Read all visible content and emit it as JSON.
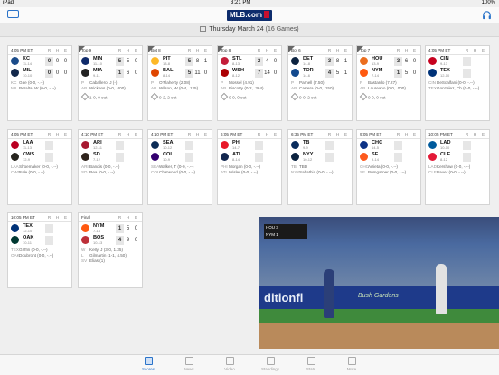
{
  "status": {
    "left": "iPad",
    "time": "3:21 PM",
    "battery": "100%"
  },
  "header": {
    "logo": "MLB.com",
    "date_bar": "Thursday March 24",
    "games": "(16 Games)"
  },
  "cards": [
    {
      "status": "4:05 PM ET",
      "t1": "KC",
      "r1": "11-14",
      "s1": [
        "0",
        "0",
        "0"
      ],
      "t2": "MIL",
      "r2": "10-10",
      "s2": [
        "0",
        "0",
        "0"
      ],
      "l1": [
        "KC",
        "Gee (0-0, -.--)"
      ],
      "l2": [
        "MIL",
        "Peralta, W (0-0, -.--)"
      ]
    },
    {
      "status": "Top 9",
      "t1": "MIN",
      "r1": "11-10",
      "s1": [
        "5",
        "5",
        "0"
      ],
      "t2": "MIA",
      "r2": "9-11",
      "s2": [
        "1",
        "6",
        "0"
      ],
      "l1": [
        "P",
        "Caballero, J (-)"
      ],
      "l2": [
        "AB",
        "Wickens (0-0, .000)"
      ],
      "outs": "1-0, 0 out"
    },
    {
      "status": "Bot 8",
      "t1": "PIT",
      "r1": "13-8",
      "s1": [
        "5",
        "8",
        "1"
      ],
      "t2": "BAL",
      "r2": "8-14",
      "s2": [
        "5",
        "11",
        "0"
      ],
      "l1": [
        "P",
        "O'Flaherty (2.08)"
      ],
      "l2": [
        "AB",
        "Wilson, W (0-4, .125)"
      ],
      "outs": "0-2, 2 out"
    },
    {
      "status": "Top 8",
      "t1": "STL",
      "r1": "8-13",
      "s1": [
        "2",
        "4",
        "0"
      ],
      "t2": "WSH",
      "r2": "8-12",
      "s2": [
        "7",
        "14",
        "0"
      ],
      "l1": [
        "P",
        "Mossel (4.91)"
      ],
      "l2": [
        "AB",
        "Piscotty (0-2, .364)"
      ],
      "outs": "0-0, 0 out"
    },
    {
      "status": "Bot 6",
      "t1": "DET",
      "r1": "14-8",
      "s1": [
        "3",
        "8",
        "1"
      ],
      "t2": "TOR",
      "r2": "14-6",
      "s2": [
        "4",
        "5",
        "1"
      ],
      "l1": [
        "P",
        "Parnell (7.50)"
      ],
      "l2": [
        "AB",
        "Carrera (0-0, .150)"
      ],
      "outs": "0-0, 2 out"
    },
    {
      "status": "Top 7",
      "t1": "HOU",
      "r1": "13-9",
      "s1": [
        "3",
        "6",
        "0"
      ],
      "t2": "NYM",
      "r2": "7-14",
      "s2": [
        "1",
        "5",
        "0"
      ],
      "l1": [
        "P",
        "Bastardo (7.27)"
      ],
      "l2": [
        "AB",
        "Laureano (0-0, .000)"
      ],
      "outs": "0-0, 0 out"
    },
    {
      "status": "4:05 PM ET",
      "t1": "CIN",
      "r1": "9-13",
      "s1": [
        "",
        "",
        ""
      ],
      "t2": "TEX",
      "r2": "12-10",
      "s2": [
        "",
        "",
        ""
      ],
      "l1": [
        "CIN",
        "DeScalfani (0-0, -.--)"
      ],
      "l2": [
        "TEX",
        "Gonzalez, Ch (0-0, -.--)"
      ]
    },
    {
      "status": "4:05 PM ET",
      "t1": "LAA",
      "r1": "11-13",
      "s1": [
        "",
        "",
        ""
      ],
      "t2": "CWS",
      "r2": "12-9",
      "s2": [
        "",
        "",
        ""
      ],
      "l1": [
        "LAA",
        "Shoemaker (0-0, -.--)"
      ],
      "l2": [
        "CWS",
        "Sale (0-0, -.--)"
      ]
    },
    {
      "status": "4:10 PM ET",
      "t1": "ARI",
      "r1": "12-11",
      "s1": [
        "",
        "",
        ""
      ],
      "t2": "SD",
      "r2": "7-12",
      "s2": [
        "",
        "",
        ""
      ],
      "l1": [
        "ARI",
        "Bandis (0-0, -.--)"
      ],
      "l2": [
        "SD",
        "Rea (0-0, -.--)"
      ]
    },
    {
      "status": "4:10 PM ET",
      "t1": "SEA",
      "r1": "10-12",
      "s1": [
        "",
        "",
        ""
      ],
      "t2": "COL",
      "r2": "10-9",
      "s2": [
        "",
        "",
        ""
      ],
      "l1": [
        "SEA",
        "Walker, T (0-0, -.--)"
      ],
      "l2": [
        "COL",
        "Chatwood (0-0, -.--)"
      ]
    },
    {
      "status": "6:05 PM ET",
      "t1": "PHI",
      "r1": "14-7",
      "s1": [
        "",
        "",
        ""
      ],
      "t2": "ATL",
      "r2": "8-14",
      "s2": [
        "",
        "",
        ""
      ],
      "l1": [
        "PHI",
        "Morgan (0-0, -.--)"
      ],
      "l2": [
        "ATL",
        "Wisler (0-0, -.--)"
      ]
    },
    {
      "status": "6:35 PM ET",
      "t1": "TB",
      "r1": "9-9",
      "s1": [
        "",
        "",
        ""
      ],
      "t2": "NYY",
      "r2": "10-12",
      "s2": [
        "",
        "",
        ""
      ],
      "l1": [
        "TB",
        "TBD"
      ],
      "l2": [
        "NYY",
        "Sabathia (0-0, -.--)"
      ]
    },
    {
      "status": "9:05 PM ET",
      "t1": "CHC",
      "r1": "14-5",
      "s1": [
        "",
        "",
        ""
      ],
      "t2": "SF",
      "r2": "9-14",
      "s2": [
        "",
        "",
        ""
      ],
      "l1": [
        "CHC",
        "Arrieta (0-0, -.--)"
      ],
      "l2": [
        "SF",
        "Bumgarner (0-0, -.--)"
      ]
    },
    {
      "status": "10:05 PM ET",
      "t1": "LAD",
      "r1": "10-10",
      "s1": [
        "",
        "",
        ""
      ],
      "t2": "CLE",
      "r2": "8-12",
      "s2": [
        "",
        "",
        ""
      ],
      "l1": [
        "LAD",
        "Kershaw (0-0, -.--)"
      ],
      "l2": [
        "CLE",
        "Bauer (0-0, -.--)"
      ]
    },
    {
      "status": "10:05 PM ET",
      "t1": "TEX",
      "r1": "12-10",
      "s1": [
        "",
        "",
        ""
      ],
      "t2": "OAK",
      "r2": "10-11",
      "s2": [
        "",
        "",
        ""
      ],
      "l1": [
        "TEX",
        "Griffin (0-0, -.--)"
      ],
      "l2": [
        "OAK",
        "Doubront (0-0, -.--)"
      ]
    },
    {
      "status": "Final",
      "t1": "NYM",
      "r1": "7-14",
      "s1": [
        "1",
        "5",
        "0"
      ],
      "t2": "BOS",
      "r2": "10-13",
      "s2": [
        "4",
        "9",
        "0"
      ],
      "l1": [
        "W",
        "Kelly, J (3-0, 1.35)"
      ],
      "l2": [
        "L",
        "Gilmartin (1-1, 4.50)"
      ],
      "l3": [
        "SV",
        "Elias (1)"
      ]
    }
  ],
  "video": {
    "wall_text": "ditionfl",
    "wall_text2": "Bush Gardens",
    "score1": "HOU  3",
    "score2": "NYM  1",
    "inning": "▲ 7"
  },
  "tabs": [
    "Scores",
    "News",
    "Video",
    "Standings",
    "Stats",
    "More"
  ],
  "colors": {
    "accent": "#2a73c9",
    "logo_bg": "#0d2c6c"
  }
}
